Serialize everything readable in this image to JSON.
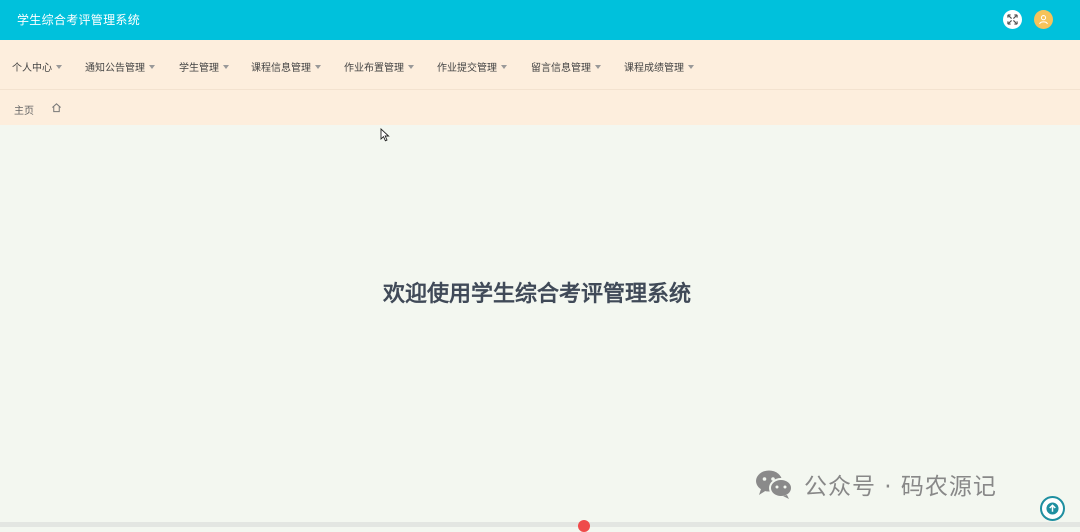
{
  "app": {
    "title": "学生综合考评管理系统"
  },
  "header": {
    "icons": [
      "fullscreen-icon",
      "user-avatar-icon"
    ],
    "colors": {
      "bar": "#00c1dc",
      "avatar": "#f6c35a"
    }
  },
  "nav": {
    "items": [
      {
        "label": "个人中心"
      },
      {
        "label": "通知公告管理"
      },
      {
        "label": "学生管理"
      },
      {
        "label": "课程信息管理"
      },
      {
        "label": "作业布置管理"
      },
      {
        "label": "作业提交管理"
      },
      {
        "label": "留言信息管理"
      },
      {
        "label": "课程成绩管理"
      }
    ]
  },
  "breadcrumb": {
    "home_label": "主页",
    "icon": "home-icon"
  },
  "main": {
    "welcome": "欢迎使用学生综合考评管理系统"
  },
  "watermark": {
    "text": "公众号 · 码农源记",
    "icon": "wechat-icon"
  },
  "back_to_top": {
    "icon": "arrow-up-icon"
  }
}
